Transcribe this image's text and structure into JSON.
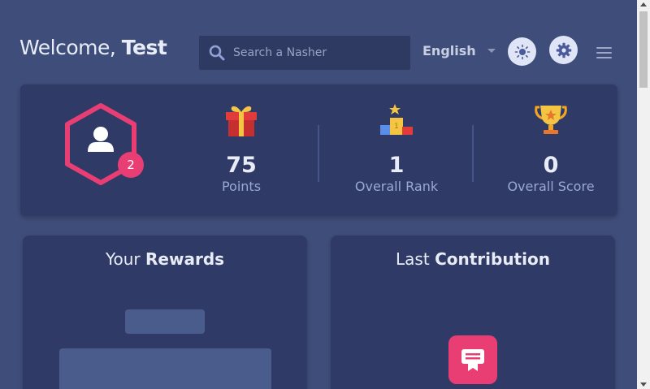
{
  "header": {
    "welcome_prefix": "Welcome,",
    "user_name": "Test",
    "search_placeholder": "Search a Nasher",
    "language": "English"
  },
  "level": "2",
  "stats": [
    {
      "value": "75",
      "label": "Points",
      "icon": "gift-icon"
    },
    {
      "value": "1",
      "label": "Overall Rank",
      "icon": "podium-icon"
    },
    {
      "value": "0",
      "label": "Overall Score",
      "icon": "trophy-icon"
    }
  ],
  "panels": {
    "rewards_prefix": "Your",
    "rewards_bold": "Rewards",
    "contribution_prefix": "Last",
    "contribution_bold": "Contribution"
  },
  "colors": {
    "background": "#3f4d7a",
    "card": "#2f3b66",
    "accent": "#e83e74",
    "muted_text": "#9aa8d4"
  }
}
